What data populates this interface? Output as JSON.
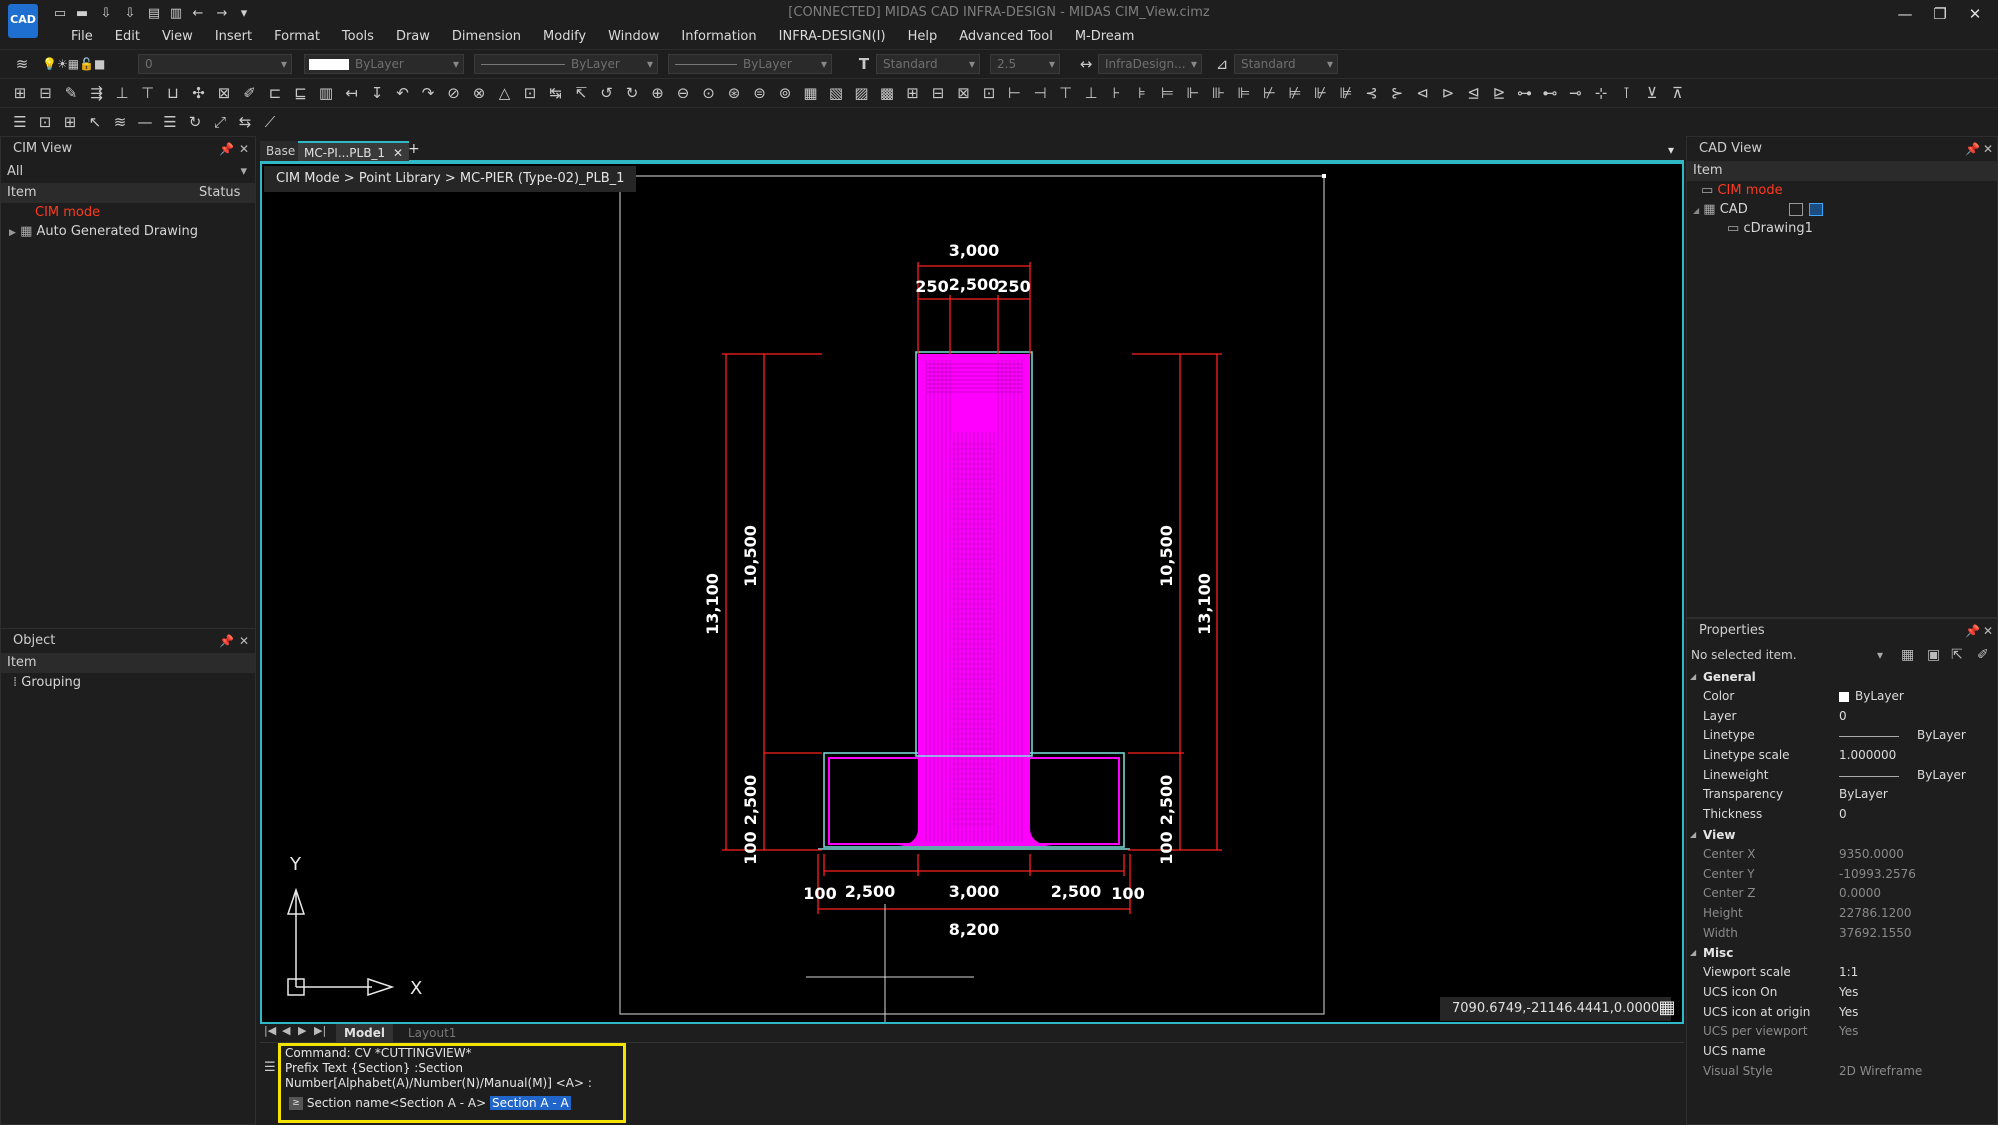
{
  "window": {
    "title": "[CONNECTED] MIDAS CAD INFRA-DESIGN - MIDAS CIM_View.cimz",
    "logo": "CAD"
  },
  "menu": [
    "File",
    "Edit",
    "View",
    "Insert",
    "Format",
    "Tools",
    "Draw",
    "Dimension",
    "Modify",
    "Window",
    "Information",
    "INFRA-DESIGN(I)",
    "Help",
    "Advanced Tool",
    "M-Dream"
  ],
  "toolbar": {
    "layer_value": "0",
    "color_value": "ByLayer",
    "linetype_value": "ByLayer",
    "lineweight_value": "ByLayer",
    "text_style": "Standard",
    "text_height": "2.5",
    "dim_style": "InfraDesign...",
    "table_style": "Standard"
  },
  "cim_view": {
    "title": "CIM View",
    "filter": "All",
    "col_item": "Item",
    "col_status": "Status",
    "items": [
      "CIM mode",
      "Auto Generated Drawing"
    ]
  },
  "object_panel": {
    "title": "Object",
    "col_item": "Item",
    "items": [
      "Grouping"
    ]
  },
  "doc_tabs": [
    "Base",
    "MC-PI...PLB_1"
  ],
  "breadcrumb": "CIM Mode > Point Library > MC-PIER (Type-02)_PLB_1",
  "drawing": {
    "dims_top": [
      "3,000",
      "250",
      "2,500",
      "250"
    ],
    "dims_side": [
      "13,100",
      "10,500",
      "2,500",
      "100"
    ],
    "dims_bottom": [
      "100",
      "2,500",
      "3,000",
      "2,500",
      "100"
    ],
    "dim_total": "8,200",
    "axis_x": "X",
    "axis_y": "Y"
  },
  "coords": "7090.6749,-21146.4441,0.0000",
  "layout_tabs": [
    "Model",
    "Layout1"
  ],
  "command": {
    "lines": [
      "Command:  CV *CUTTINGVIEW*",
      "Prefix Text {Section} :Section",
      "Number[Alphabet(A)/Number(N)/Manual(M)] <A> :"
    ],
    "prompt": "Section name<Section A - A>",
    "input": "Section A - A"
  },
  "cad_view": {
    "title": "CAD View",
    "col_item": "Item",
    "items": [
      "CIM mode",
      "CAD",
      "cDrawing1"
    ]
  },
  "properties": {
    "title": "Properties",
    "selection": "No selected item.",
    "general_title": "General",
    "general": [
      {
        "k": "Color",
        "v": "ByLayer"
      },
      {
        "k": "Layer",
        "v": "0"
      },
      {
        "k": "Linetype",
        "v": "ByLayer"
      },
      {
        "k": "Linetype scale",
        "v": "1.000000"
      },
      {
        "k": "Lineweight",
        "v": "ByLayer"
      },
      {
        "k": "Transparency",
        "v": "ByLayer"
      },
      {
        "k": "Thickness",
        "v": "0"
      }
    ],
    "view_title": "View",
    "view": [
      {
        "k": "Center X",
        "v": "9350.0000"
      },
      {
        "k": "Center Y",
        "v": "-10993.2576"
      },
      {
        "k": "Center Z",
        "v": "0.0000"
      },
      {
        "k": "Height",
        "v": "22786.1200"
      },
      {
        "k": "Width",
        "v": "37692.1550"
      }
    ],
    "misc_title": "Misc",
    "misc": [
      {
        "k": "Viewport scale",
        "v": "1:1"
      },
      {
        "k": "UCS icon On",
        "v": "Yes"
      },
      {
        "k": "UCS icon at origin",
        "v": "Yes"
      },
      {
        "k": "UCS per viewport",
        "v": "Yes"
      },
      {
        "k": "UCS name",
        "v": ""
      },
      {
        "k": "Visual Style",
        "v": "2D Wireframe"
      }
    ]
  }
}
